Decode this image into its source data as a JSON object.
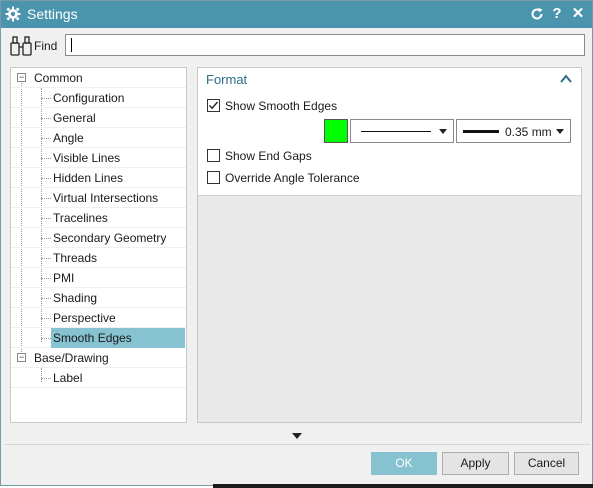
{
  "window": {
    "title": "Settings",
    "titlebar_color": "#4a95ad",
    "buttons": {
      "refresh_icon": "refresh-icon",
      "help": "?",
      "close": "✕"
    }
  },
  "find": {
    "label": "Find",
    "value": "",
    "placeholder": ""
  },
  "tree": {
    "items": [
      {
        "label": "Common",
        "level": 0,
        "expander": "−"
      },
      {
        "label": "Configuration",
        "level": 1
      },
      {
        "label": "General",
        "level": 1
      },
      {
        "label": "Angle",
        "level": 1
      },
      {
        "label": "Visible Lines",
        "level": 1
      },
      {
        "label": "Hidden Lines",
        "level": 1
      },
      {
        "label": "Virtual Intersections",
        "level": 1
      },
      {
        "label": "Tracelines",
        "level": 1
      },
      {
        "label": "Secondary Geometry",
        "level": 1
      },
      {
        "label": "Threads",
        "level": 1
      },
      {
        "label": "PMI",
        "level": 1
      },
      {
        "label": "Shading",
        "level": 1
      },
      {
        "label": "Perspective",
        "level": 1
      },
      {
        "label": "Smooth Edges",
        "level": 1,
        "selected": true
      },
      {
        "label": "Base/Drawing",
        "level": 0,
        "expander": "−"
      },
      {
        "label": "Label",
        "level": 1
      }
    ]
  },
  "format": {
    "title": "Format",
    "show_smooth_edges": {
      "label": "Show Smooth Edges",
      "checked": true
    },
    "color": "#00ff00",
    "line_font": "solid",
    "line_width": "0.35 mm",
    "show_end_gaps": {
      "label": "Show End Gaps",
      "checked": false
    },
    "override_angle_tolerance": {
      "label": "Override Angle Tolerance",
      "checked": false
    }
  },
  "footer": {
    "ok": "OK",
    "apply": "Apply",
    "cancel": "Cancel",
    "accent": "#86c2d0"
  }
}
